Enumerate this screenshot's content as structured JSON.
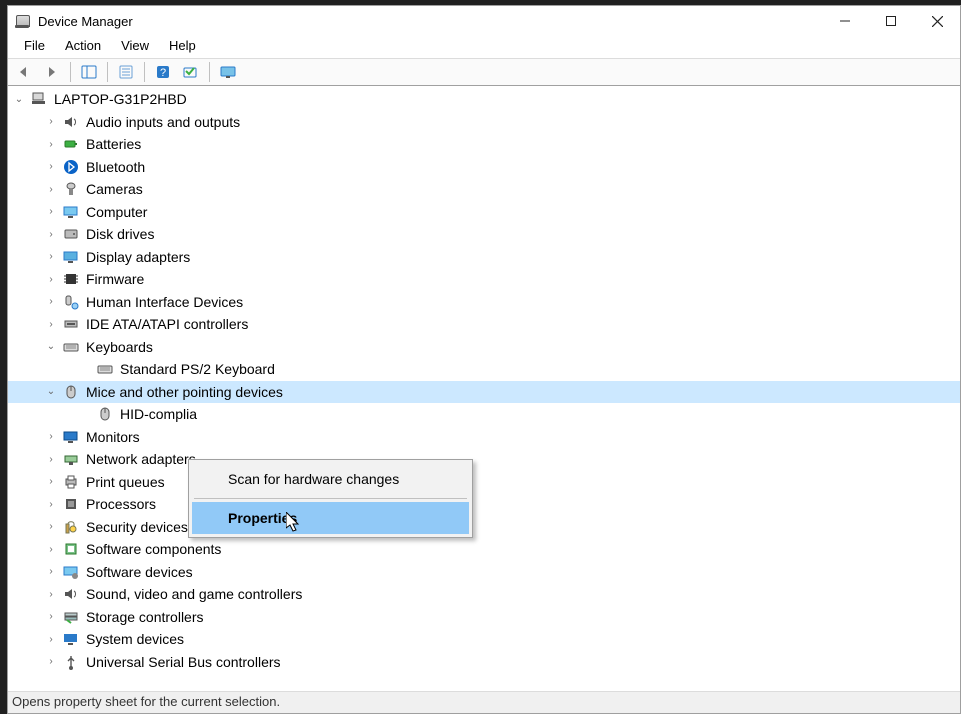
{
  "window": {
    "title": "Device Manager"
  },
  "menus": {
    "file": "File",
    "action": "Action",
    "view": "View",
    "help": "Help"
  },
  "tree": {
    "root": "LAPTOP-G31P2HBD",
    "items": [
      {
        "label": "Audio inputs and outputs",
        "icon": "speaker"
      },
      {
        "label": "Batteries",
        "icon": "battery"
      },
      {
        "label": "Bluetooth",
        "icon": "bluetooth"
      },
      {
        "label": "Cameras",
        "icon": "camera"
      },
      {
        "label": "Computer",
        "icon": "monitor"
      },
      {
        "label": "Disk drives",
        "icon": "disk"
      },
      {
        "label": "Display adapters",
        "icon": "display"
      },
      {
        "label": "Firmware",
        "icon": "chip"
      },
      {
        "label": "Human Interface Devices",
        "icon": "hid"
      },
      {
        "label": "IDE ATA/ATAPI controllers",
        "icon": "ide"
      },
      {
        "label": "Keyboards",
        "icon": "keyboard",
        "expanded": true,
        "children": [
          {
            "label": "Standard PS/2 Keyboard",
            "icon": "keyboard"
          }
        ]
      },
      {
        "label": "Mice and other pointing devices",
        "icon": "mouse",
        "expanded": true,
        "selected": true,
        "children": [
          {
            "label": "HID-complia",
            "icon": "mouse"
          }
        ]
      },
      {
        "label": "Monitors",
        "icon": "monitor-blue"
      },
      {
        "label": "Network adapters",
        "icon": "network"
      },
      {
        "label": "Print queues",
        "icon": "printer"
      },
      {
        "label": "Processors",
        "icon": "cpu"
      },
      {
        "label": "Security devices",
        "icon": "security"
      },
      {
        "label": "Software components",
        "icon": "swcomp"
      },
      {
        "label": "Software devices",
        "icon": "swdev"
      },
      {
        "label": "Sound, video and game controllers",
        "icon": "speaker"
      },
      {
        "label": "Storage controllers",
        "icon": "storage"
      },
      {
        "label": "System devices",
        "icon": "system"
      },
      {
        "label": "Universal Serial Bus controllers",
        "icon": "usb"
      }
    ]
  },
  "context_menu": {
    "scan": "Scan for hardware changes",
    "properties": "Properties"
  },
  "statusbar": "Opens property sheet for the current selection."
}
